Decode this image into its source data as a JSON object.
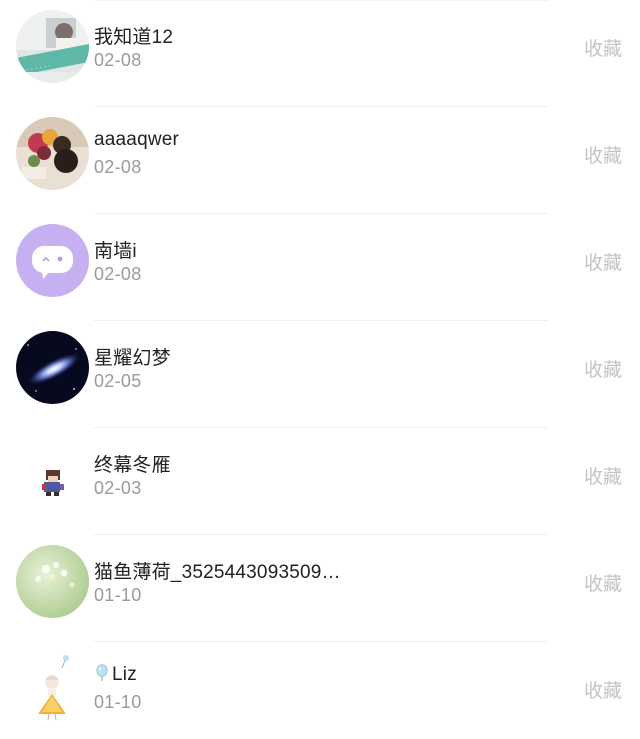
{
  "list": {
    "items": [
      {
        "name": "我知道12",
        "date": "02-08",
        "action": "收藏",
        "avatar_icon": "avatar-photo-book"
      },
      {
        "name": "aaaaqwer",
        "date": "02-08",
        "action": "收藏",
        "avatar_icon": "avatar-photo-flowers"
      },
      {
        "name": "南墙i",
        "date": "02-08",
        "action": "收藏",
        "avatar_icon": "avatar-chat-bubble"
      },
      {
        "name": "星耀幻梦",
        "date": "02-05",
        "action": "收藏",
        "avatar_icon": "avatar-galaxy"
      },
      {
        "name": "终幕冬雁",
        "date": "02-03",
        "action": "收藏",
        "avatar_icon": "avatar-pixel-character"
      },
      {
        "name": "猫鱼薄荷_3525443093509…",
        "date": "01-10",
        "action": "收藏",
        "avatar_icon": "avatar-green-flowers"
      },
      {
        "name": "Liz",
        "date": "01-10",
        "action": "收藏",
        "avatar_icon": "avatar-anime-girl",
        "name_prefix_icon": "balloon-icon"
      }
    ]
  },
  "colors": {
    "name_text": "#222222",
    "date_text": "#9a9a9a",
    "action_text": "#c4c4c4",
    "divider": "#efefef"
  }
}
